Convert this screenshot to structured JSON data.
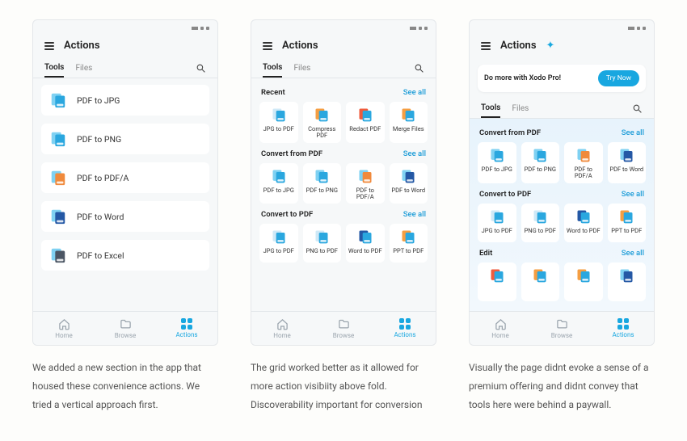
{
  "see_all": "See all",
  "nav": {
    "home": "Home",
    "browse": "Browse",
    "actions": "Actions"
  },
  "tabs": {
    "tools": "Tools",
    "files": "Files"
  },
  "screens": [
    {
      "title": "Actions",
      "list": [
        {
          "label": "PDF to JPG",
          "icon": "pdf-jpg"
        },
        {
          "label": "PDF to PNG",
          "icon": "pdf-png"
        },
        {
          "label": "PDF to PDF/A",
          "icon": "pdf-pdfa"
        },
        {
          "label": "PDF to Word",
          "icon": "pdf-word"
        },
        {
          "label": "PDF to Excel",
          "icon": "pdf-excel"
        }
      ],
      "caption": "We added a new section in the app that housed these convenience actions. We tried a vertical approach first."
    },
    {
      "title": "Actions",
      "sections": [
        {
          "title": "Recent",
          "items": [
            {
              "label": "JPG to PDF",
              "icon": "jpg-pdf"
            },
            {
              "label": "Compress PDF",
              "icon": "compress"
            },
            {
              "label": "Redact PDF",
              "icon": "redact"
            },
            {
              "label": "Merge Files",
              "icon": "merge"
            }
          ]
        },
        {
          "title": "Convert from PDF",
          "items": [
            {
              "label": "PDF to JPG",
              "icon": "pdf-jpg"
            },
            {
              "label": "PDF to PNG",
              "icon": "pdf-png"
            },
            {
              "label": "PDF to PDF/A",
              "icon": "pdf-pdfa"
            },
            {
              "label": "PDF to Word",
              "icon": "pdf-word"
            }
          ]
        },
        {
          "title": "Convert to PDF",
          "items": [
            {
              "label": "JPG to PDF",
              "icon": "jpg-pdf"
            },
            {
              "label": "PNG to PDF",
              "icon": "png-pdf"
            },
            {
              "label": "Word to PDF",
              "icon": "word-pdf"
            },
            {
              "label": "PPT to PDF",
              "icon": "ppt-pdf"
            }
          ]
        }
      ],
      "caption": "The grid worked better as it allowed for more action visibiity above fold. Discoverability important for conversion"
    },
    {
      "title": "Actions",
      "premium": true,
      "promo": {
        "text": "Do more with Xodo Pro!",
        "cta": "Try Now"
      },
      "sections": [
        {
          "title": "Convert from PDF",
          "items": [
            {
              "label": "PDF to JPG",
              "icon": "pdf-jpg"
            },
            {
              "label": "PDF to PNG",
              "icon": "pdf-png"
            },
            {
              "label": "PDF to PDF/A",
              "icon": "pdf-pdfa"
            },
            {
              "label": "PDF to Word",
              "icon": "pdf-word"
            }
          ]
        },
        {
          "title": "Convert to PDF",
          "items": [
            {
              "label": "JPG to PDF",
              "icon": "jpg-pdf"
            },
            {
              "label": "PNG to PDF",
              "icon": "png-pdf"
            },
            {
              "label": "Word to PDF",
              "icon": "word-pdf"
            },
            {
              "label": "PPT to PDF",
              "icon": "ppt-pdf"
            }
          ]
        },
        {
          "title": "Edit",
          "items": [
            {
              "label": "",
              "icon": "redact"
            },
            {
              "label": "",
              "icon": "compress"
            },
            {
              "label": "",
              "icon": "merge"
            },
            {
              "label": "",
              "icon": "pdf-word"
            }
          ]
        }
      ],
      "caption": "Visually the page didnt evoke a sense of a premium offering and didnt convey that tools here were behind a paywall."
    }
  ]
}
